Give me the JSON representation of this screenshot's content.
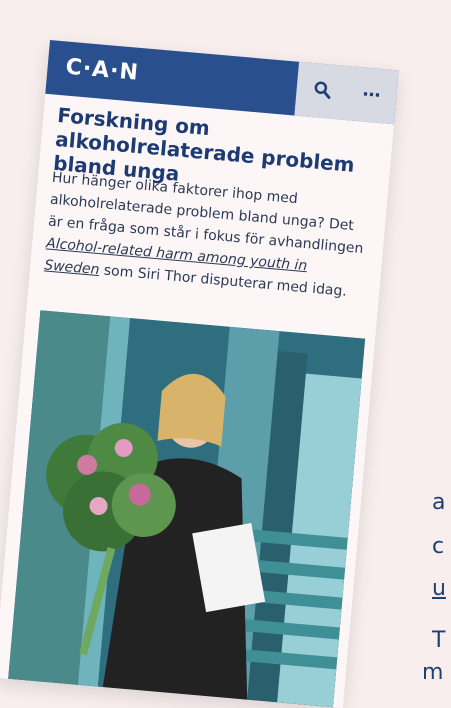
{
  "header": {
    "logo": "C·A·N",
    "search_icon": "search-icon",
    "more_icon": "more-icon",
    "more_label": "…"
  },
  "article": {
    "title": "Forskning om alkoholrelaterade problem bland unga",
    "lead_before": "Hur hänger olika faktorer ihop med alkoholrelaterade problem bland unga? Det är en fråga som står i fokus för avhandlingen ",
    "lead_link": "Alcohol-related harm among youth in Sweden",
    "lead_after": " som Siri Thor disputerar med idag."
  },
  "background_fragment": {
    "a": "a",
    "c": "c",
    "u": "u",
    "t": "T",
    "m": "m"
  }
}
